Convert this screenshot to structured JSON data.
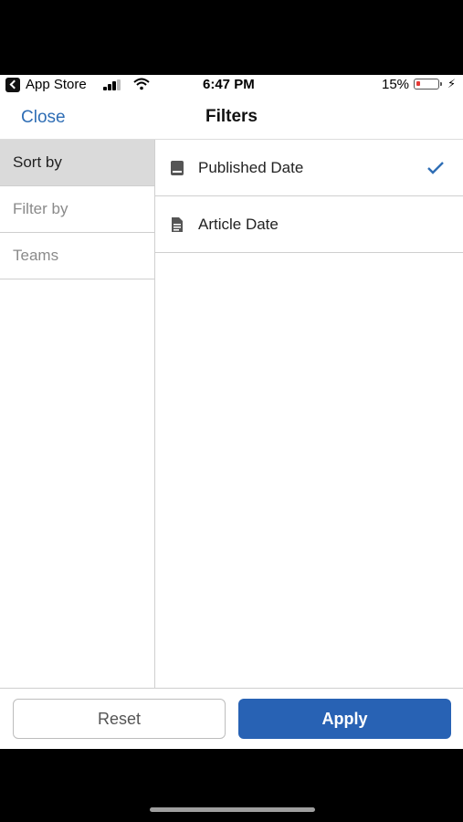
{
  "status_bar": {
    "carrier": "App Store",
    "time": "6:47 PM",
    "battery_percent": "15%",
    "battery_level": 0.15,
    "icons": [
      "back-arrow-icon",
      "signal-icon",
      "wifi-icon",
      "battery-icon",
      "charging-bolt-icon"
    ]
  },
  "header": {
    "close_label": "Close",
    "title": "Filters"
  },
  "sidebar": {
    "items": [
      {
        "label": "Sort by",
        "active": true
      },
      {
        "label": "Filter by",
        "active": false
      },
      {
        "label": "Teams",
        "active": false
      }
    ]
  },
  "options": {
    "items": [
      {
        "label": "Published Date",
        "icon": "book-icon",
        "selected": true
      },
      {
        "label": "Article Date",
        "icon": "document-icon",
        "selected": false
      }
    ],
    "check_icon": "checkmark-icon"
  },
  "footer": {
    "reset_label": "Reset",
    "apply_label": "Apply"
  },
  "colors": {
    "accent": "#2f6eb5",
    "apply_bg": "#2862b4",
    "active_sidebar_bg": "#dadada",
    "battery_low": "#e53935"
  }
}
